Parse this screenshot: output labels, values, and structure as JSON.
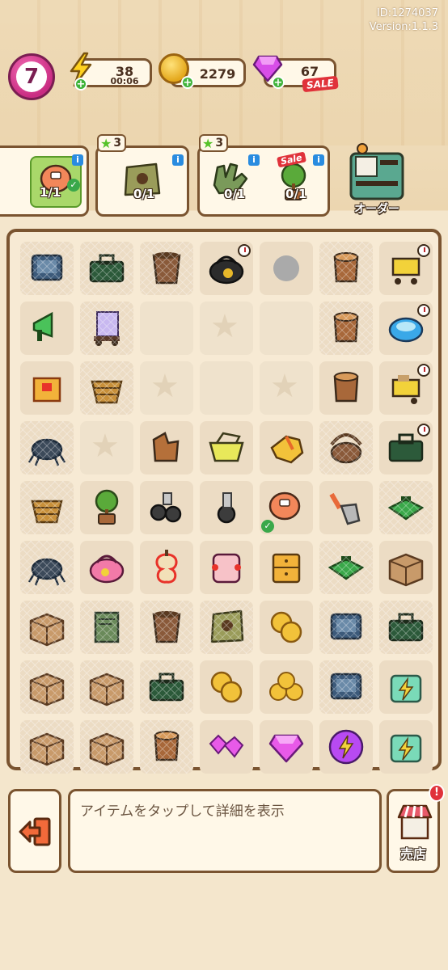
{
  "meta": {
    "id_text": "ID:1274037",
    "version_text": "Version:1.1.3"
  },
  "player": {
    "level": "7"
  },
  "resources": {
    "energy": {
      "value": "38",
      "timer": "00:06",
      "icon": "lightning-icon"
    },
    "coins": {
      "value": "2279",
      "icon": "coin-icon"
    },
    "gems": {
      "value": "67",
      "icon": "gem-icon",
      "badge": "SALE"
    }
  },
  "orders": [
    {
      "items": [
        {
          "icon": "pillow-item",
          "count": "1/1",
          "done": true
        }
      ]
    },
    {
      "stars": "3",
      "items": [
        {
          "icon": "coffee-bag-item",
          "count": "0/1"
        }
      ]
    },
    {
      "stars": "3",
      "items": [
        {
          "icon": "gloves-item",
          "count": "0/1"
        },
        {
          "icon": "plant-item",
          "count": "0/1",
          "badge": "Sale"
        }
      ]
    }
  ],
  "order_button": {
    "label": "オーダー"
  },
  "board": {
    "cells": [
      [
        "tablet-web",
        "toolbox-web",
        "bucket-web",
        "bag-black-clock",
        "tray-green",
        "stump-web",
        "cart-clock"
      ],
      [
        "megaphone",
        "cart-boxes-web",
        "empty",
        "star",
        "empty",
        "stump-web",
        "robot-clock"
      ],
      [
        "box-glow",
        "basket-web",
        "star",
        "empty",
        "star",
        "stump",
        "cart-yellow-clock"
      ],
      [
        "spider-web",
        "star",
        "stump-broken",
        "basket-yellow",
        "glove",
        "basket-round-web",
        "toolbox-clock"
      ],
      [
        "basket-web",
        "plant",
        "wheels",
        "wheel",
        "pillow-check",
        "shovel",
        "tray-web"
      ],
      [
        "spider-web",
        "bag-pink",
        "apple",
        "bag-pink2",
        "drawer",
        "tray-web",
        "box"
      ],
      [
        "box-web",
        "paper-web",
        "bucket-web",
        "coffee-bag-web",
        "coins",
        "tablet-web",
        "toolbox-web"
      ],
      [
        "box-web",
        "box-web",
        "toolbox-web",
        "coins",
        "coins-pile",
        "tablet-web",
        "energy-box"
      ],
      [
        "box-web",
        "box-web",
        "stump-web",
        "gems",
        "gem",
        "energy-orb",
        "energy-box"
      ]
    ]
  },
  "bottom": {
    "info_text": "アイテムをタップして詳細を表示",
    "exit_icon": "exit-icon",
    "shop_label": "売店",
    "shop_alert": "!"
  }
}
